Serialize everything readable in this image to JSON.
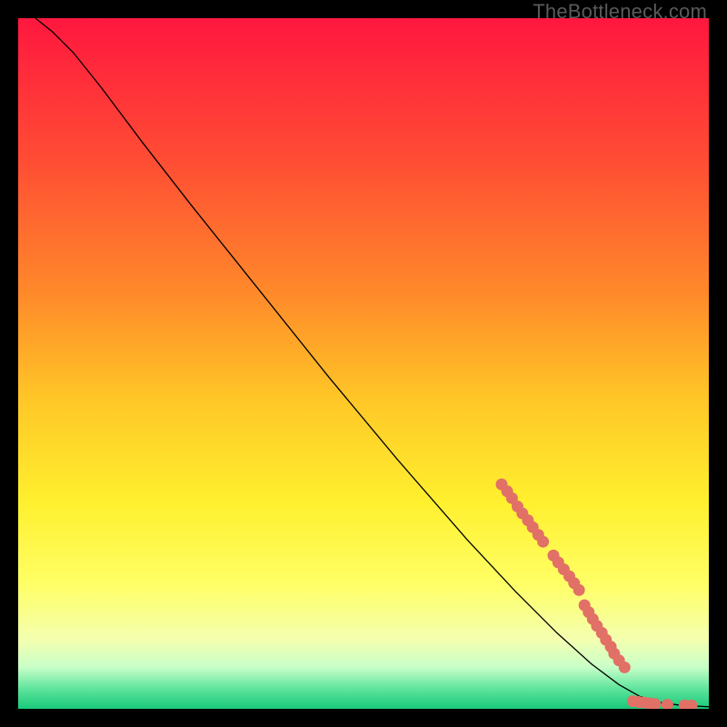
{
  "watermark": "TheBottleneck.com",
  "chart_data": {
    "type": "line",
    "title": "",
    "xlabel": "",
    "ylabel": "",
    "xlim": [
      0,
      100
    ],
    "ylim": [
      0,
      100
    ],
    "background_gradient": {
      "stops": [
        {
          "pct": 0,
          "color": "#ff173f"
        },
        {
          "pct": 20,
          "color": "#ff4b34"
        },
        {
          "pct": 40,
          "color": "#ff8a2a"
        },
        {
          "pct": 55,
          "color": "#ffc627"
        },
        {
          "pct": 70,
          "color": "#fff02e"
        },
        {
          "pct": 82,
          "color": "#ffff66"
        },
        {
          "pct": 90,
          "color": "#f4ffb0"
        },
        {
          "pct": 94,
          "color": "#c8ffc8"
        },
        {
          "pct": 97,
          "color": "#61e59e"
        },
        {
          "pct": 100,
          "color": "#18c97a"
        }
      ]
    },
    "series": [
      {
        "name": "curve",
        "color": "#000000",
        "width": 1.3,
        "points": [
          {
            "x": 2.5,
            "y": 100.0
          },
          {
            "x": 5.0,
            "y": 98.0
          },
          {
            "x": 8.0,
            "y": 95.0
          },
          {
            "x": 12.0,
            "y": 90.0
          },
          {
            "x": 18.0,
            "y": 82.0
          },
          {
            "x": 25.0,
            "y": 73.0
          },
          {
            "x": 35.0,
            "y": 60.5
          },
          {
            "x": 45.0,
            "y": 48.0
          },
          {
            "x": 55.0,
            "y": 36.0
          },
          {
            "x": 65.0,
            "y": 24.5
          },
          {
            "x": 72.0,
            "y": 17.0
          },
          {
            "x": 78.0,
            "y": 11.0
          },
          {
            "x": 83.0,
            "y": 6.5
          },
          {
            "x": 87.0,
            "y": 3.5
          },
          {
            "x": 90.0,
            "y": 1.8
          },
          {
            "x": 93.0,
            "y": 0.9
          },
          {
            "x": 96.0,
            "y": 0.5
          },
          {
            "x": 100.0,
            "y": 0.3
          }
        ]
      }
    ],
    "markers": {
      "color": "#e17066",
      "radius": 6.5,
      "points": [
        {
          "x": 70.0,
          "y": 32.5
        },
        {
          "x": 70.8,
          "y": 31.5
        },
        {
          "x": 71.5,
          "y": 30.5
        },
        {
          "x": 72.3,
          "y": 29.3
        },
        {
          "x": 73.0,
          "y": 28.3
        },
        {
          "x": 73.8,
          "y": 27.3
        },
        {
          "x": 74.5,
          "y": 26.3
        },
        {
          "x": 75.3,
          "y": 25.2
        },
        {
          "x": 76.0,
          "y": 24.2
        },
        {
          "x": 77.5,
          "y": 22.2
        },
        {
          "x": 78.2,
          "y": 21.2
        },
        {
          "x": 79.0,
          "y": 20.2
        },
        {
          "x": 79.8,
          "y": 19.2
        },
        {
          "x": 80.5,
          "y": 18.2
        },
        {
          "x": 81.2,
          "y": 17.2
        },
        {
          "x": 82.0,
          "y": 15.0
        },
        {
          "x": 82.6,
          "y": 14.0
        },
        {
          "x": 83.2,
          "y": 13.0
        },
        {
          "x": 83.8,
          "y": 12.0
        },
        {
          "x": 84.5,
          "y": 11.0
        },
        {
          "x": 85.1,
          "y": 10.0
        },
        {
          "x": 85.8,
          "y": 9.0
        },
        {
          "x": 86.3,
          "y": 8.0
        },
        {
          "x": 87.0,
          "y": 7.0
        },
        {
          "x": 87.8,
          "y": 6.0
        },
        {
          "x": 89.0,
          "y": 1.1
        },
        {
          "x": 89.8,
          "y": 1.0
        },
        {
          "x": 90.6,
          "y": 0.9
        },
        {
          "x": 91.4,
          "y": 0.8
        },
        {
          "x": 92.2,
          "y": 0.7
        },
        {
          "x": 94.0,
          "y": 0.6
        },
        {
          "x": 96.5,
          "y": 0.5
        },
        {
          "x": 97.5,
          "y": 0.5
        }
      ]
    }
  }
}
